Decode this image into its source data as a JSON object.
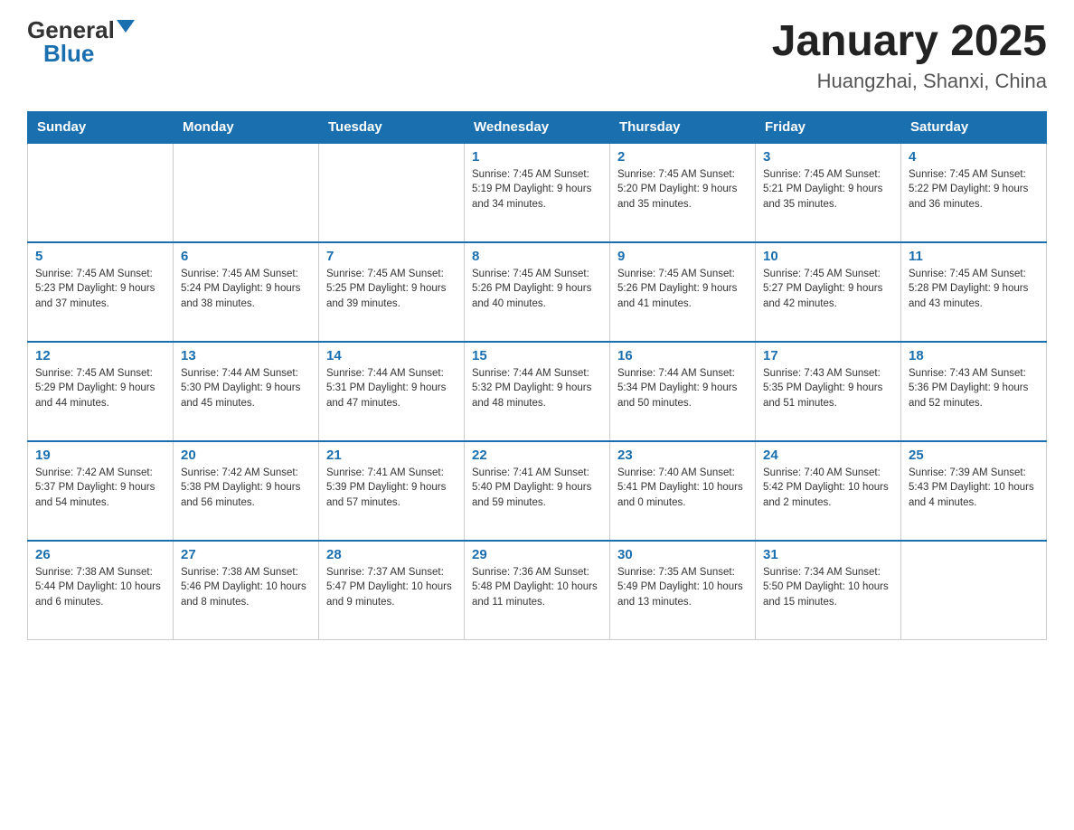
{
  "header": {
    "logo_general": "General",
    "logo_blue": "Blue",
    "month": "January 2025",
    "location": "Huangzhai, Shanxi, China"
  },
  "weekdays": [
    "Sunday",
    "Monday",
    "Tuesday",
    "Wednesday",
    "Thursday",
    "Friday",
    "Saturday"
  ],
  "weeks": [
    [
      {
        "day": "",
        "info": ""
      },
      {
        "day": "",
        "info": ""
      },
      {
        "day": "",
        "info": ""
      },
      {
        "day": "1",
        "info": "Sunrise: 7:45 AM\nSunset: 5:19 PM\nDaylight: 9 hours\nand 34 minutes."
      },
      {
        "day": "2",
        "info": "Sunrise: 7:45 AM\nSunset: 5:20 PM\nDaylight: 9 hours\nand 35 minutes."
      },
      {
        "day": "3",
        "info": "Sunrise: 7:45 AM\nSunset: 5:21 PM\nDaylight: 9 hours\nand 35 minutes."
      },
      {
        "day": "4",
        "info": "Sunrise: 7:45 AM\nSunset: 5:22 PM\nDaylight: 9 hours\nand 36 minutes."
      }
    ],
    [
      {
        "day": "5",
        "info": "Sunrise: 7:45 AM\nSunset: 5:23 PM\nDaylight: 9 hours\nand 37 minutes."
      },
      {
        "day": "6",
        "info": "Sunrise: 7:45 AM\nSunset: 5:24 PM\nDaylight: 9 hours\nand 38 minutes."
      },
      {
        "day": "7",
        "info": "Sunrise: 7:45 AM\nSunset: 5:25 PM\nDaylight: 9 hours\nand 39 minutes."
      },
      {
        "day": "8",
        "info": "Sunrise: 7:45 AM\nSunset: 5:26 PM\nDaylight: 9 hours\nand 40 minutes."
      },
      {
        "day": "9",
        "info": "Sunrise: 7:45 AM\nSunset: 5:26 PM\nDaylight: 9 hours\nand 41 minutes."
      },
      {
        "day": "10",
        "info": "Sunrise: 7:45 AM\nSunset: 5:27 PM\nDaylight: 9 hours\nand 42 minutes."
      },
      {
        "day": "11",
        "info": "Sunrise: 7:45 AM\nSunset: 5:28 PM\nDaylight: 9 hours\nand 43 minutes."
      }
    ],
    [
      {
        "day": "12",
        "info": "Sunrise: 7:45 AM\nSunset: 5:29 PM\nDaylight: 9 hours\nand 44 minutes."
      },
      {
        "day": "13",
        "info": "Sunrise: 7:44 AM\nSunset: 5:30 PM\nDaylight: 9 hours\nand 45 minutes."
      },
      {
        "day": "14",
        "info": "Sunrise: 7:44 AM\nSunset: 5:31 PM\nDaylight: 9 hours\nand 47 minutes."
      },
      {
        "day": "15",
        "info": "Sunrise: 7:44 AM\nSunset: 5:32 PM\nDaylight: 9 hours\nand 48 minutes."
      },
      {
        "day": "16",
        "info": "Sunrise: 7:44 AM\nSunset: 5:34 PM\nDaylight: 9 hours\nand 50 minutes."
      },
      {
        "day": "17",
        "info": "Sunrise: 7:43 AM\nSunset: 5:35 PM\nDaylight: 9 hours\nand 51 minutes."
      },
      {
        "day": "18",
        "info": "Sunrise: 7:43 AM\nSunset: 5:36 PM\nDaylight: 9 hours\nand 52 minutes."
      }
    ],
    [
      {
        "day": "19",
        "info": "Sunrise: 7:42 AM\nSunset: 5:37 PM\nDaylight: 9 hours\nand 54 minutes."
      },
      {
        "day": "20",
        "info": "Sunrise: 7:42 AM\nSunset: 5:38 PM\nDaylight: 9 hours\nand 56 minutes."
      },
      {
        "day": "21",
        "info": "Sunrise: 7:41 AM\nSunset: 5:39 PM\nDaylight: 9 hours\nand 57 minutes."
      },
      {
        "day": "22",
        "info": "Sunrise: 7:41 AM\nSunset: 5:40 PM\nDaylight: 9 hours\nand 59 minutes."
      },
      {
        "day": "23",
        "info": "Sunrise: 7:40 AM\nSunset: 5:41 PM\nDaylight: 10 hours\nand 0 minutes."
      },
      {
        "day": "24",
        "info": "Sunrise: 7:40 AM\nSunset: 5:42 PM\nDaylight: 10 hours\nand 2 minutes."
      },
      {
        "day": "25",
        "info": "Sunrise: 7:39 AM\nSunset: 5:43 PM\nDaylight: 10 hours\nand 4 minutes."
      }
    ],
    [
      {
        "day": "26",
        "info": "Sunrise: 7:38 AM\nSunset: 5:44 PM\nDaylight: 10 hours\nand 6 minutes."
      },
      {
        "day": "27",
        "info": "Sunrise: 7:38 AM\nSunset: 5:46 PM\nDaylight: 10 hours\nand 8 minutes."
      },
      {
        "day": "28",
        "info": "Sunrise: 7:37 AM\nSunset: 5:47 PM\nDaylight: 10 hours\nand 9 minutes."
      },
      {
        "day": "29",
        "info": "Sunrise: 7:36 AM\nSunset: 5:48 PM\nDaylight: 10 hours\nand 11 minutes."
      },
      {
        "day": "30",
        "info": "Sunrise: 7:35 AM\nSunset: 5:49 PM\nDaylight: 10 hours\nand 13 minutes."
      },
      {
        "day": "31",
        "info": "Sunrise: 7:34 AM\nSunset: 5:50 PM\nDaylight: 10 hours\nand 15 minutes."
      },
      {
        "day": "",
        "info": ""
      }
    ]
  ]
}
